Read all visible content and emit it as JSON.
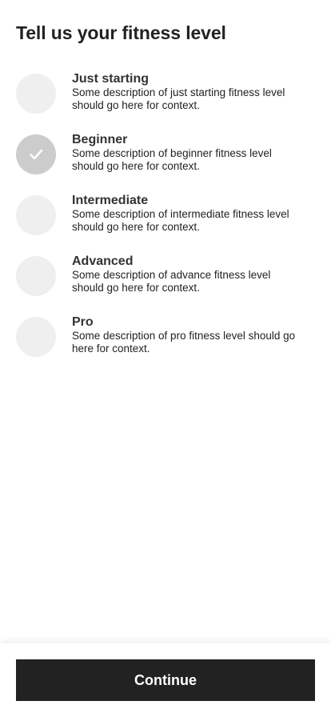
{
  "page": {
    "title": "Tell us your fitness level"
  },
  "options": [
    {
      "title": "Just starting",
      "description": "Some description of just starting fitness level\nshould go here for context.",
      "selected": false
    },
    {
      "title": "Beginner",
      "description": "Some description of beginner fitness level\nshould go here for context.",
      "selected": true
    },
    {
      "title": "Intermediate",
      "description": "Some description of intermediate fitness level\nshould go here for context.",
      "selected": false
    },
    {
      "title": "Advanced",
      "description": "Some description of advance fitness level\nshould go here for context.",
      "selected": false
    },
    {
      "title": "Pro",
      "description": "Some description of pro fitness level  should go\nhere for context.",
      "selected": false
    }
  ],
  "footer": {
    "continue_label": "Continue"
  },
  "colors": {
    "primary": "#222222",
    "radio_unselected": "#efefef",
    "radio_selected": "#cccccc",
    "check": "#ffffff"
  },
  "icons": {
    "selected_mark": "checkmark-icon"
  }
}
